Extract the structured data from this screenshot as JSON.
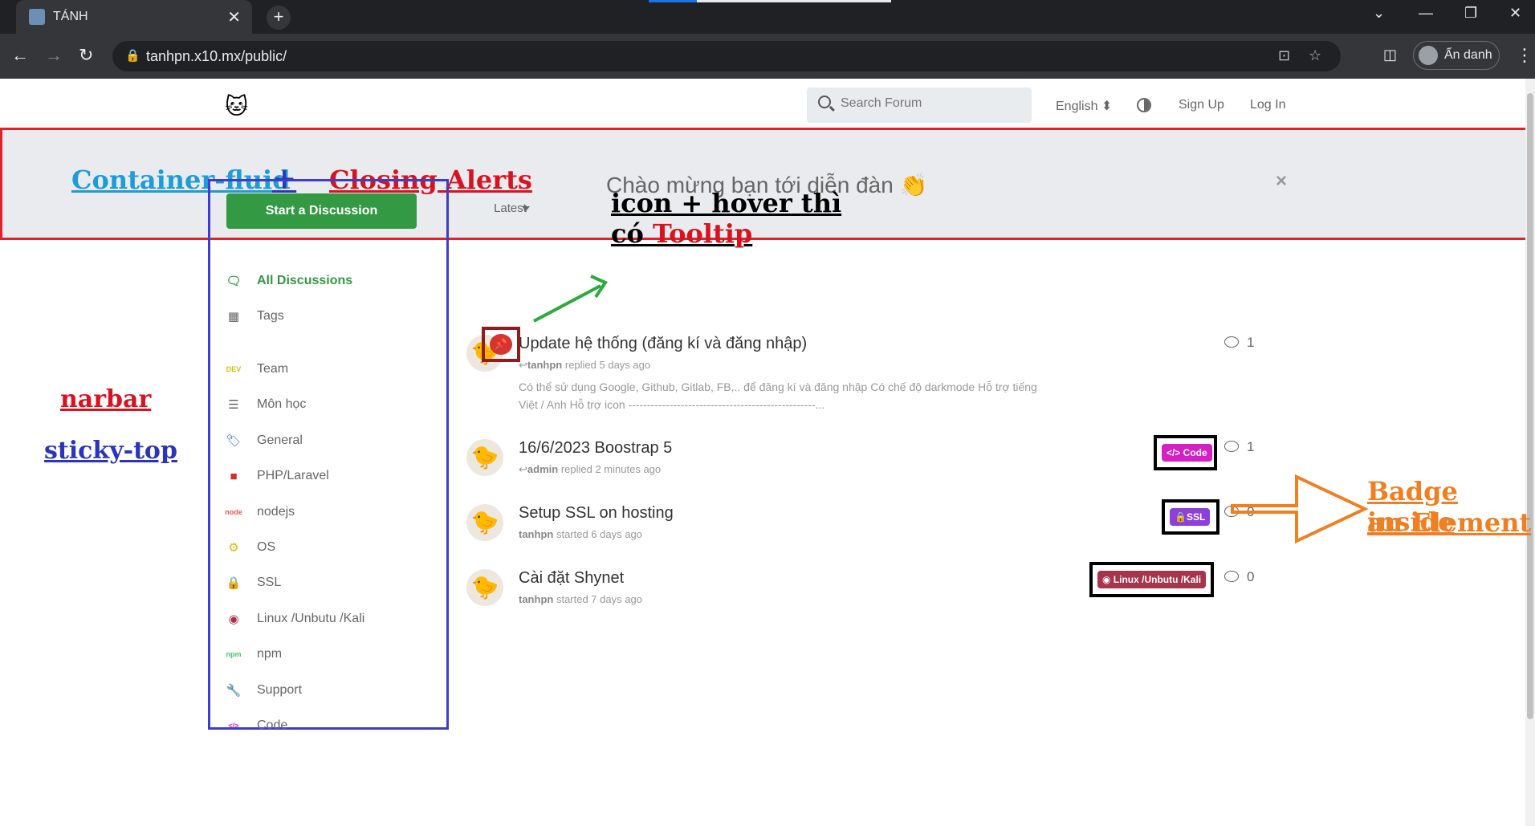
{
  "browser": {
    "tab_title": "TÁNH",
    "tab_close": "✕",
    "new_tab": "+",
    "url": "tanhpn.x10.mx/public/",
    "profile_label": "Ẩn danh",
    "win_min": "—",
    "win_restore": "❐",
    "win_close": "✕",
    "tab_list": "⌄",
    "back": "←",
    "forward": "→",
    "reload": "↻",
    "more": "⋮",
    "translate": "⊡",
    "star": "☆",
    "sidepanel": "◫"
  },
  "header": {
    "logo": "🐱",
    "search_placeholder": "Search Forum",
    "language": "English ⬍",
    "sign_up": "Sign Up",
    "log_in": "Log In"
  },
  "alert": {
    "message": "Chào mừng bạn tới diễn đàn 👏",
    "close": "×"
  },
  "annotations": {
    "container_fluid": "Container-fluid",
    "plus": "+",
    "closing_alerts": "Closing Alerts",
    "narbar": "narbar",
    "sticky_top": "sticky-top",
    "tooltip_line1": "icon + hover thì",
    "tooltip_line2_a": "có ",
    "tooltip_line2_b": "Tooltip",
    "badge_line1": "Badge inside",
    "badge_line2": "an Element"
  },
  "sidebar": {
    "start_button": "Start a Discussion",
    "items": [
      {
        "label": "All Discussions",
        "icon": "comments-icon",
        "glyph": "🗨",
        "color": "#349943"
      },
      {
        "label": "Tags",
        "icon": "th-large-icon",
        "glyph": "▦",
        "color": "#666666"
      },
      {
        "label": "Team",
        "icon": "dev-icon",
        "glyph": "DEV",
        "color": "#d1c20c"
      },
      {
        "label": "Môn học",
        "icon": "list-alt-icon",
        "glyph": "☰",
        "color": "#666666"
      },
      {
        "label": "General",
        "icon": "tags-icon",
        "glyph": "🏷",
        "color": "#2a6ed6"
      },
      {
        "label": "PHP/Laravel",
        "icon": "square-icon",
        "glyph": "■",
        "color": "#c8312f"
      },
      {
        "label": "nodejs",
        "icon": "node-icon",
        "glyph": "node",
        "color": "#e25a4b"
      },
      {
        "label": "OS",
        "icon": "cogs-icon",
        "glyph": "⚙",
        "color": "#e8b40c"
      },
      {
        "label": "SSL",
        "icon": "lock-icon",
        "glyph": "🔒",
        "color": "#8e3fd9"
      },
      {
        "label": "Linux /Unbutu /Kali",
        "icon": "ubuntu-icon",
        "glyph": "◉",
        "color": "#a6344b"
      },
      {
        "label": "npm",
        "icon": "npm-icon",
        "glyph": "npm",
        "color": "#3ec95f"
      },
      {
        "label": "Support",
        "icon": "wrench-icon",
        "glyph": "🔧",
        "color": "#6b5a12"
      },
      {
        "label": "Code",
        "icon": "code-icon",
        "glyph": "</>",
        "color": "#d420c5"
      }
    ]
  },
  "list": {
    "sort_label": "Latest",
    "discussions": [
      {
        "title": "Update hệ thống (đăng kí và đăng nhập)",
        "author": "tanhpn",
        "action": "replied 5 days ago",
        "reply_icon": true,
        "excerpt": "Có thể sử dụng Google, Github, Gitlab, FB,.. để đăng kí và đăng nhập Có chế độ darkmode Hỗ trợ tiếng Việt / Anh Hỗ trợ icon --------------------------------------------------...",
        "replies": "1",
        "pinned": true,
        "avatar": "🐤"
      },
      {
        "title": "16/6/2023 Boostrap 5",
        "author": "admin",
        "action": "replied 2 minutes ago",
        "reply_icon": true,
        "replies": "1",
        "tag": "</> Code",
        "tag_color": "#d420c5",
        "avatar": "🐤"
      },
      {
        "title": "Setup SSL on hosting",
        "author": "tanhpn",
        "action": "started 6 days ago",
        "replies": "0",
        "tag": "🔒SSL",
        "tag_color": "#8e3fd9",
        "avatar": "🐤"
      },
      {
        "title": "Cài đặt Shynet",
        "author": "tanhpn",
        "action": "started 7 days ago",
        "replies": "0",
        "tag": "◉ Linux /Unbutu /Kali",
        "tag_color": "#a6344b",
        "avatar": "🐤"
      }
    ]
  },
  "colors": {
    "alert_border": "#e0232a",
    "sidebar_border": "#3d3dc9",
    "primary_green": "#349943",
    "arrow_green": "#2aab3c",
    "arrow_orange": "#ef7f22"
  }
}
